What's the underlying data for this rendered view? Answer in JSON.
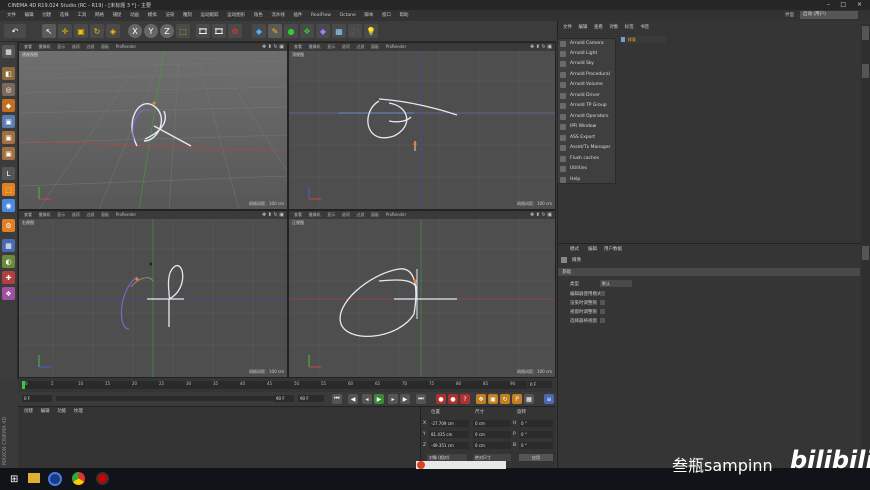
{
  "window": {
    "title": "CINEMA 4D R19.024 Studio (RC - R19) - [未标题 3 *] - 主要"
  },
  "menu": [
    "文件",
    "编辑",
    "创建",
    "选择",
    "工具",
    "网格",
    "捕捉",
    "动画",
    "模拟",
    "渲染",
    "雕刻",
    "运动跟踪",
    "运动图形",
    "角色",
    "流水线",
    "插件",
    "RealFlow",
    "Octane",
    "脚本",
    "窗口",
    "帮助"
  ],
  "layout": {
    "label": "界面",
    "value": "启动 (用户)"
  },
  "viewport_menu": [
    "查看",
    "摄像机",
    "显示",
    "选项",
    "过滤",
    "面板",
    "ProRender"
  ],
  "viewports": [
    {
      "name": "透视视图",
      "footer": "网格间距：100 cm"
    },
    {
      "name": "顶视图",
      "footer": "网格间距：100 cm"
    },
    {
      "name": "右视图",
      "footer": "网格间距：100 cm"
    },
    {
      "name": "正视图",
      "footer": "网格间距：100 cm"
    }
  ],
  "timeline": {
    "ticks": [
      "0",
      "5",
      "10",
      "15",
      "20",
      "25",
      "30",
      "35",
      "40",
      "45",
      "50",
      "55",
      "60",
      "65",
      "70",
      "75",
      "80",
      "85",
      "90"
    ],
    "frame_end": "0 F",
    "start_field": "0 F",
    "end_field": "90 F",
    "end_field2": "90 F"
  },
  "material_panel": {
    "menu": [
      "创建",
      "编辑",
      "功能",
      "纹理"
    ]
  },
  "coordinates": {
    "headers": [
      "位置",
      "尺寸",
      "旋转"
    ],
    "rows": [
      {
        "axis": "X",
        "pos": "-27.709 cm",
        "size": "0 cm",
        "rot_axis": "H",
        "rot": "0 °"
      },
      {
        "axis": "Y",
        "pos": "81.435 cm",
        "size": "0 cm",
        "rot_axis": "P",
        "rot": "0 °"
      },
      {
        "axis": "Z",
        "pos": "-49.351 cm",
        "size": "0 cm",
        "rot_axis": "B",
        "rot": "0 °"
      }
    ],
    "mode": "对象 (相对)",
    "size_mode": "绝对尺寸",
    "apply_label": "应用"
  },
  "object_manager": {
    "menu": [
      "文件",
      "编辑",
      "查看",
      "对象",
      "标签",
      "书签"
    ],
    "object_name": "样条",
    "dropdown_items": [
      "Arnold Camera",
      "Arnold Light",
      "Arnold Sky",
      "Arnold Procedural",
      "Arnold Volume",
      "Arnold Driver",
      "Arnold TP Group",
      "Arnold Operators",
      "IPR Window",
      "ASS Export",
      "Asset/Tx Manager",
      "Flush caches",
      "Utilities",
      "Help"
    ]
  },
  "attributes": {
    "menu": [
      "模式",
      "编辑",
      "用户数据"
    ],
    "title": "摄像",
    "section": "基础",
    "type_label": "类型",
    "type_value": "默认",
    "rows": [
      "编辑器使用模式",
      "渲染时调整限",
      "视窗时调整限",
      "选择器将视窗"
    ]
  },
  "watermark": "叁瓶sampinn",
  "brand": "bilibili",
  "side_brand": "MAXON CINEMA 4D"
}
